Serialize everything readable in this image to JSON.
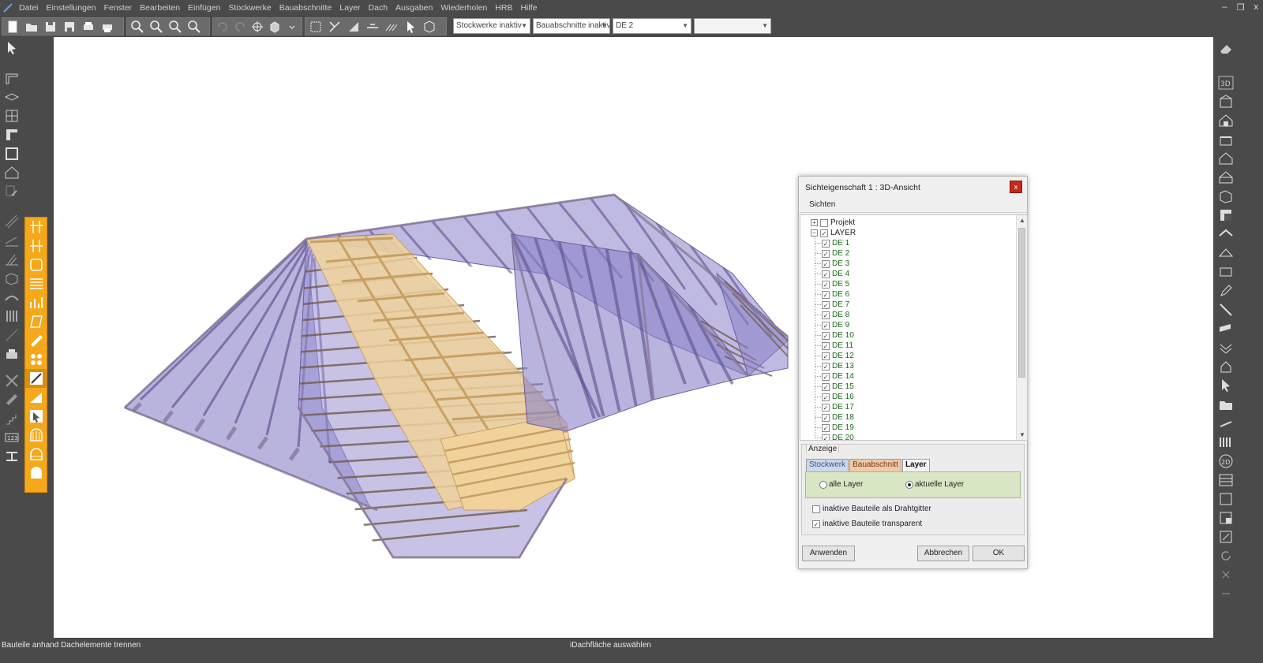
{
  "menubar": {
    "items": [
      "Datei",
      "Einstellungen",
      "Fenster",
      "Bearbeiten",
      "Einfügen",
      "Stockwerke",
      "Bauabschnitte",
      "Layer",
      "Dach",
      "Ausgaben",
      "Wiederholen",
      "HRB",
      "Hilfe"
    ],
    "minimize": "–",
    "restore": "❐",
    "close": "x"
  },
  "toolbar": {
    "stockwerke_select": "Stockwerke inaktiv",
    "bauabschnitte_select": "Bauabschnitte inaktiv",
    "layer_select": "DE 2",
    "empty_select": ""
  },
  "dialog": {
    "title": "Sichteigenschaft 1 : 3D-Ansicht",
    "close": "x",
    "menu": "Sichten",
    "tree": {
      "projekt": "Projekt",
      "layer_root": "LAYER",
      "layers": [
        "DE 1",
        "DE 2",
        "DE 3",
        "DE 4",
        "DE 5",
        "DE 6",
        "DE 7",
        "DE 8",
        "DE 9",
        "DE 10",
        "DE 11",
        "DE 12",
        "DE 13",
        "DE 14",
        "DE 15",
        "DE 16",
        "DE 17",
        "DE 18",
        "DE 19",
        "DE 20"
      ],
      "plus": "+",
      "minus": "−",
      "check": "✓"
    },
    "anzeige": {
      "legend": "Anzeige",
      "tabs": [
        "Stockwerk",
        "Bauabschnitt",
        "Layer"
      ],
      "radio_all": "alle Layer",
      "radio_current": "aktuelle Layer",
      "cb_wireframe": "inaktive Bauteile als Drahtgitter",
      "cb_transparent": "inaktive Bauteile transparent"
    },
    "buttons": {
      "apply": "Anwenden",
      "cancel": "Abbrechen",
      "ok": "OK"
    }
  },
  "statusbar": {
    "left": "Bauteile anhand Dachelemente trennen",
    "center": "iDachfläche auswählen"
  },
  "colors": {
    "roof_transparent": "#8a82c8",
    "roof_active": "#f0d29a",
    "timber": "#c8a064",
    "toolbar_orange": "#f5a81a"
  }
}
